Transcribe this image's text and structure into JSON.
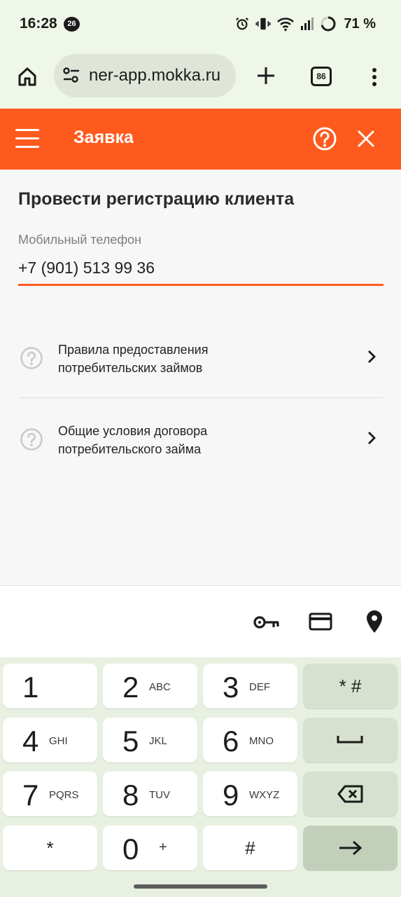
{
  "status_bar": {
    "time": "16:28",
    "notification_count": "26",
    "battery": "71 %"
  },
  "browser": {
    "url": "ner-app.mokka.ru",
    "tab_count": "86"
  },
  "header": {
    "title": "Заявка",
    "accent_color": "#ff5a1e"
  },
  "main": {
    "title": "Провести регистрацию клиента",
    "phone_field": {
      "label": "Мобильный телефон",
      "value": "+7 (901) 513 99 36"
    },
    "documents": [
      {
        "line1": "Правила предоставления",
        "line2": "потребительских займов"
      },
      {
        "line1": "Общие условия договора",
        "line2": "потребительского займа"
      }
    ]
  },
  "keyboard": {
    "autofill_icons": [
      "key-icon",
      "credit-card-icon",
      "location-pin-icon"
    ],
    "keys": [
      {
        "digit": "1",
        "letters": ""
      },
      {
        "digit": "2",
        "letters": "ABC"
      },
      {
        "digit": "3",
        "letters": "DEF"
      },
      {
        "digit": "4",
        "letters": "GHI"
      },
      {
        "digit": "5",
        "letters": "JKL"
      },
      {
        "digit": "6",
        "letters": "MNO"
      },
      {
        "digit": "7",
        "letters": "PQRS"
      },
      {
        "digit": "8",
        "letters": "TUV"
      },
      {
        "digit": "9",
        "letters": "WXYZ"
      },
      {
        "digit": "0",
        "letters": "+"
      }
    ],
    "star_hash": "* #",
    "star": "*",
    "hash": "#"
  }
}
